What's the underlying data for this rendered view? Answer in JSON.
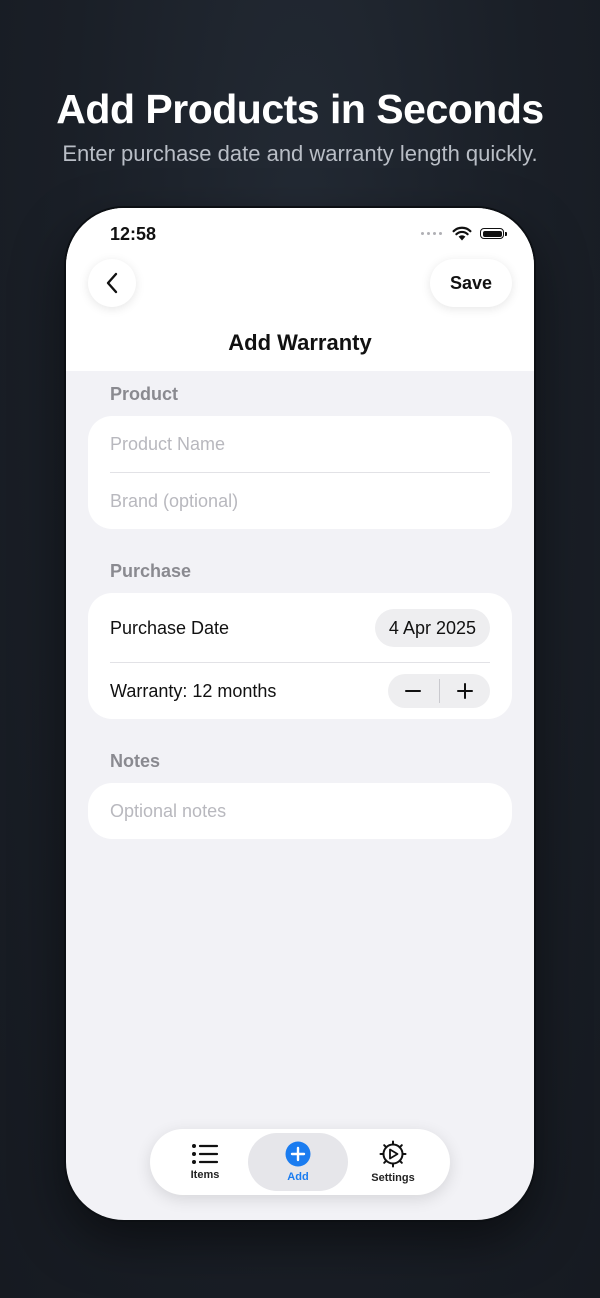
{
  "promo": {
    "title": "Add Products in Seconds",
    "subtitle": "Enter purchase date and warranty length quickly."
  },
  "status_bar": {
    "time": "12:58",
    "icons": [
      "signal-dots-icon",
      "wifi-icon",
      "battery-icon"
    ]
  },
  "nav": {
    "back_icon": "chevron-left-icon",
    "title": "Add Warranty",
    "save_label": "Save"
  },
  "sections": {
    "product": {
      "header": "Product",
      "name_placeholder": "Product Name",
      "brand_placeholder": "Brand (optional)"
    },
    "purchase": {
      "header": "Purchase",
      "date_label": "Purchase Date",
      "date_value": "4 Apr 2025",
      "warranty_label": "Warranty: 12 months",
      "decrement_symbol": "−",
      "increment_symbol": "+"
    },
    "notes": {
      "header": "Notes",
      "placeholder": "Optional notes"
    }
  },
  "tab_bar": {
    "tabs": [
      {
        "label": "Items",
        "icon": "list-icon",
        "active": false
      },
      {
        "label": "Add",
        "icon": "plus-circle-icon",
        "active": true
      },
      {
        "label": "Settings",
        "icon": "gear-icon",
        "active": false
      }
    ]
  },
  "colors": {
    "accent": "#1a7cf0",
    "background": "#1a1f27",
    "surface": "#f2f2f6",
    "card": "#ffffff",
    "placeholder": "#b8b8be",
    "section_header": "#8a8a90"
  }
}
